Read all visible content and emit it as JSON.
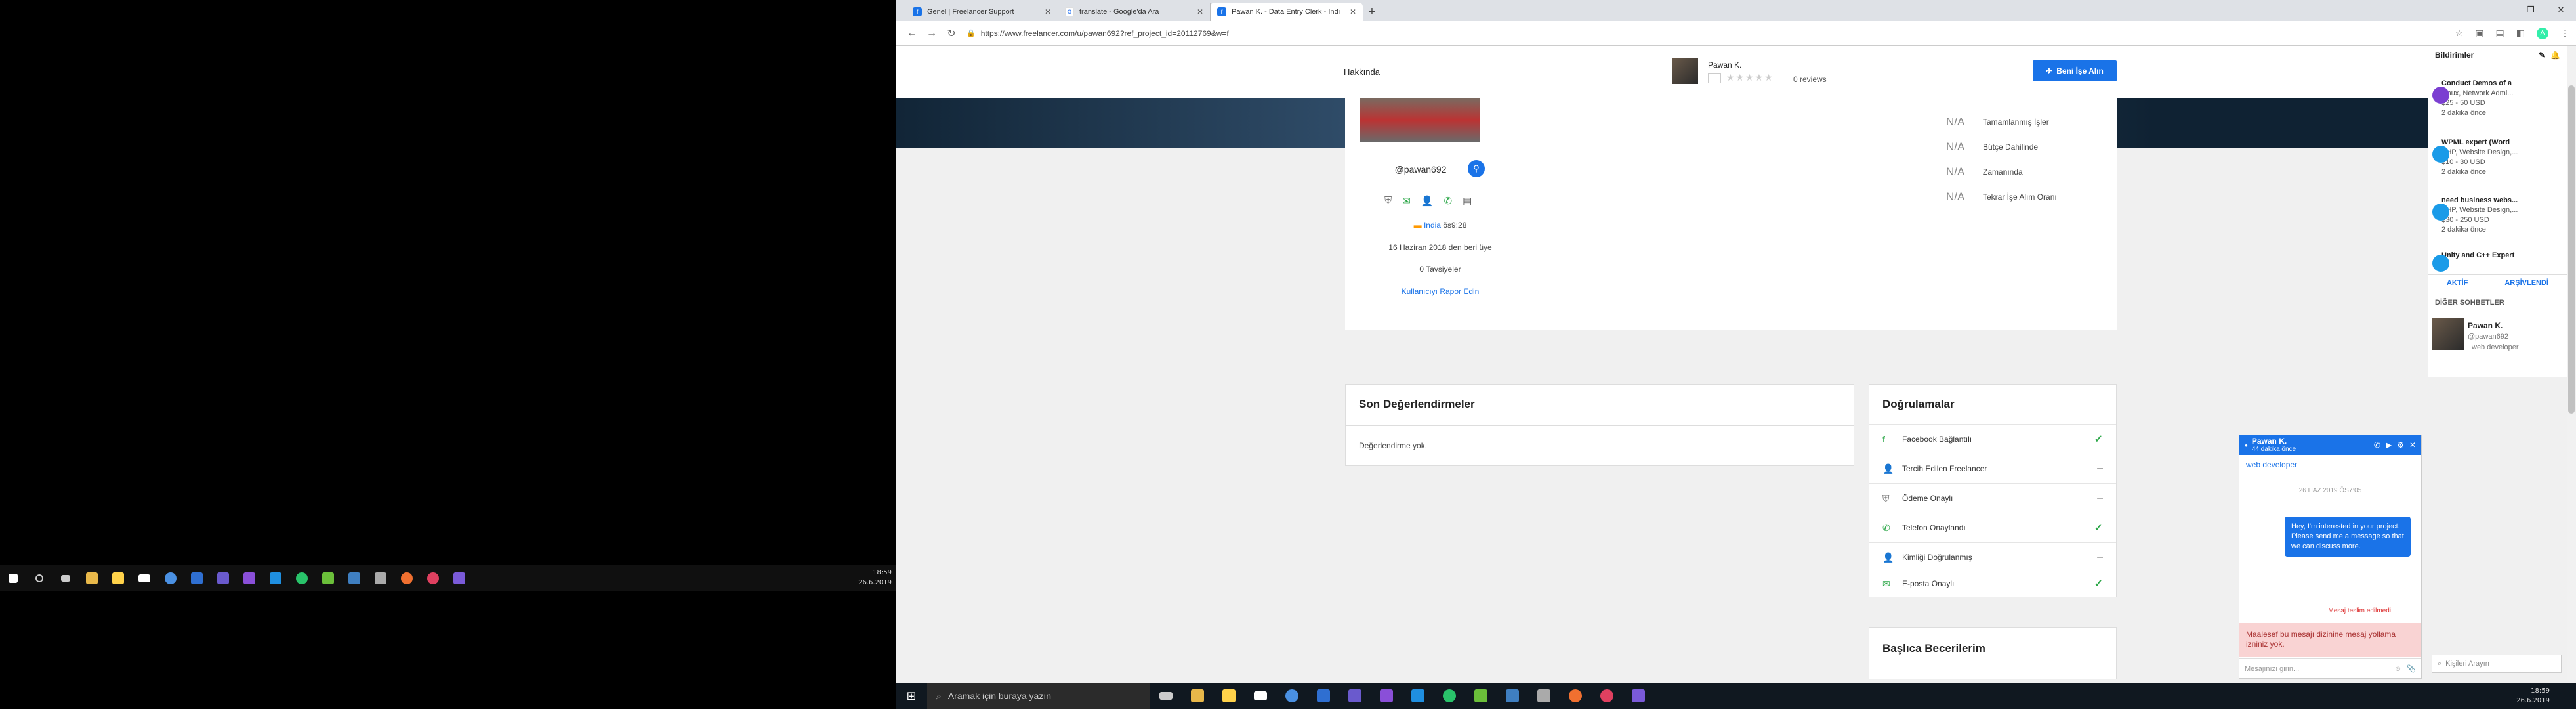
{
  "left_taskbar": {
    "icon_colors": [
      "#ffffff",
      "#cccccc",
      "#cccccc",
      "#e8b84a",
      "#ffd24a",
      "#ffffff",
      "#4a90e2",
      "#2f6fd1",
      "#6a5acd",
      "#8a4fd8",
      "#1f8fe0",
      "#29c36a",
      "#6bbf3a",
      "#3f7fc1",
      "#aaaaaa",
      "#f07030",
      "#e04060",
      "#7a5ad8"
    ],
    "clock_time": "18:59",
    "clock_date": "26.6.2019"
  },
  "browser": {
    "tabs": [
      {
        "label": "Genel | Freelancer Support",
        "icon": "freelancer-icon",
        "color": "#1a73e8"
      },
      {
        "label": "translate - Google'da Ara",
        "icon": "google-icon",
        "color": "#ffffff"
      },
      {
        "label": "Pawan K. - Data Entry Clerk - Indi",
        "icon": "freelancer-icon",
        "color": "#1a73e8"
      }
    ],
    "url": "https://www.freelancer.com/u/pawan692?ref_project_id=20112769&w=f",
    "profile_initial": "A"
  },
  "header": {
    "about": "Hakkında",
    "name": "Pawan K.",
    "reviews": "0 reviews",
    "hire_button": "Beni İşe Alın"
  },
  "profile": {
    "username": "@pawan692",
    "country": "India",
    "local_time": "ös9:28",
    "member_since": "16 Haziran 2018 den beri üye",
    "recommendations": "0 Tavsiyeler",
    "report": "Kullanıcıyı Rapor Edin",
    "stats": [
      {
        "value": "N/A",
        "label": "Tamamlanmış İşler"
      },
      {
        "value": "N/A",
        "label": "Bütçe Dahilinde"
      },
      {
        "value": "N/A",
        "label": "Zamanında"
      },
      {
        "value": "N/A",
        "label": "Tekrar İşe Alım Oranı"
      }
    ]
  },
  "reviews_section": {
    "title": "Son Değerlendirmeler",
    "empty": "Değerlendirme yok."
  },
  "verifications": {
    "title": "Doğrulamalar",
    "items": [
      {
        "label": "Facebook Bağlantılı",
        "icon": "facebook-icon",
        "status": "✓",
        "ok": true
      },
      {
        "label": "Tercih Edilen Freelancer",
        "icon": "preferred-icon",
        "status": "–",
        "ok": false
      },
      {
        "label": "Ödeme Onaylı",
        "icon": "shield-icon",
        "status": "–",
        "ok": false
      },
      {
        "label": "Telefon Onaylandı",
        "icon": "phone-icon",
        "status": "✓",
        "ok": true
      },
      {
        "label": "Kimliği Doğrulanmış",
        "icon": "user-icon",
        "status": "–",
        "ok": false
      },
      {
        "label": "E-posta Onaylı",
        "icon": "mail-icon",
        "status": "✓",
        "ok": true
      }
    ]
  },
  "skills": {
    "title": "Başlıca Becerilerim"
  },
  "notifications": {
    "header": "Bildirimler",
    "items": [
      {
        "title": "Conduct Demos of a",
        "desc": "Linux, Network Admi...",
        "price": "$25 - 50 USD",
        "time": "2 dakika önce",
        "color": "#7b3fd1"
      },
      {
        "title": "WPML expert (Word",
        "desc": "PHP, Website Design,...",
        "price": "$10 - 30 USD",
        "time": "2 dakika önce",
        "color": "#1a9be8"
      },
      {
        "title": "need business webs...",
        "desc": "PHP, Website Design,...",
        "price": "$30 - 250 USD",
        "time": "2 dakika önce",
        "color": "#1a9be8"
      },
      {
        "title": "Unity and C++ Expert",
        "desc": "",
        "price": "",
        "time": "",
        "color": "#1a9be8"
      }
    ],
    "tab_active": "AKTİF",
    "tab_archived": "ARŞİVLENDİ",
    "other_chats": "DİĞER SOHBETLER",
    "contact": {
      "name": "Pawan K.",
      "username": "@pawan692",
      "role": "web developer"
    },
    "search_placeholder": "Kişileri Arayın"
  },
  "chat": {
    "name": "Pawan K.",
    "time": "44 dakika önce",
    "role": "web developer",
    "date": "26 HAZ 2019   ÖS7:05",
    "message": "Hey, I'm interested in your project. Please send me a message so that we can discuss more.",
    "error": "Mesaj teslim edilmedi",
    "warning": "Maalesef bu mesajı dizinine mesaj yollama izniniz yok.",
    "input_placeholder": "Mesajınızı girin..."
  },
  "right_taskbar": {
    "search_placeholder": "Aramak için buraya yazın",
    "icon_colors": [
      "#cccccc",
      "#e8b84a",
      "#ffd24a",
      "#ffffff",
      "#4a90e2",
      "#2f6fd1",
      "#6a5acd",
      "#8a4fd8",
      "#1f8fe0",
      "#29c36a",
      "#6bbf3a",
      "#3f7fc1",
      "#aaaaaa",
      "#f07030",
      "#e04060",
      "#7a5ad8"
    ],
    "clock_time": "18:59",
    "clock_date": "26.6.2019"
  }
}
